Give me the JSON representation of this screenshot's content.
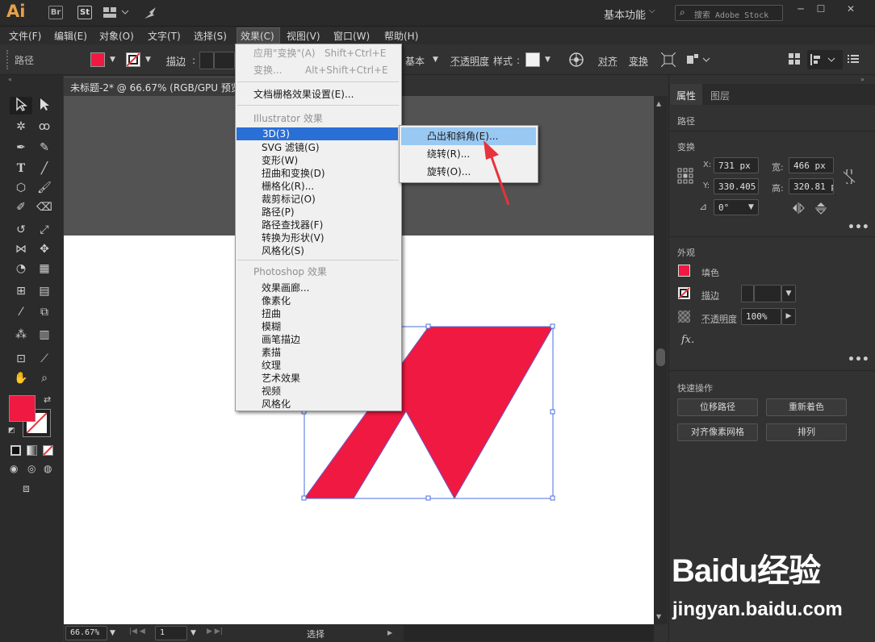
{
  "app": {
    "logo": "Ai",
    "bridge": "Br",
    "stock": "St",
    "workspace": "基本功能",
    "search_placeholder": "搜索 Adobe Stock"
  },
  "menubar": [
    "文件(F)",
    "编辑(E)",
    "对象(O)",
    "文字(T)",
    "选择(S)",
    "效果(C)",
    "视图(V)",
    "窗口(W)",
    "帮助(H)"
  ],
  "control": {
    "selection_type": "路径",
    "stroke_label": "描边",
    "style_label": "基本",
    "opacity_label": "不透明度",
    "styles_label": "样式",
    "align_label": "对齐",
    "transform_label": "变换",
    "fill_color": "#ef1941"
  },
  "document": {
    "tab_title": "未标题-2* @ 66.67% (RGB/GPU 预览)",
    "zoom": "66.67%",
    "artboard_index": "1",
    "status": "选择"
  },
  "effect_menu": {
    "apply_last": "应用\"变换\"(A)",
    "apply_last_shortcut": "Shift+Ctrl+E",
    "last_effect": "变换...",
    "last_effect_shortcut": "Alt+Shift+Ctrl+E",
    "raster_settings": "文档栅格效果设置(E)...",
    "illustrator_header": "Illustrator 效果",
    "illustrator_items": [
      "3D(3)",
      "SVG 滤镜(G)",
      "变形(W)",
      "扭曲和变换(D)",
      "栅格化(R)...",
      "裁剪标记(O)",
      "路径(P)",
      "路径查找器(F)",
      "转换为形状(V)",
      "风格化(S)"
    ],
    "photoshop_header": "Photoshop 效果",
    "photoshop_items": [
      "效果画廊...",
      "像素化",
      "扭曲",
      "模糊",
      "画笔描边",
      "素描",
      "纹理",
      "艺术效果",
      "视频",
      "风格化"
    ]
  },
  "submenu_3d": [
    "凸出和斜角(E)...",
    "绕转(R)...",
    "旋转(O)..."
  ],
  "properties_panel": {
    "tabs": [
      "属性",
      "图层"
    ],
    "object_type": "路径",
    "transform_title": "变换",
    "x_label": "X:",
    "x": "731 px",
    "y_label": "Y:",
    "y": "330.405",
    "w_label": "宽:",
    "w": "466 px",
    "h_label": "高:",
    "h": "320.81 p",
    "angle": "0°",
    "appearance_title": "外观",
    "fill_label": "填色",
    "stroke_label": "描边",
    "opacity_label": "不透明度",
    "opacity": "100%",
    "fx": "fx.",
    "quick_actions_title": "快速操作",
    "btn_offset_path": "位移路径",
    "btn_recolor": "重新着色",
    "btn_align_pixel": "对齐像素网格",
    "btn_arrange": "排列"
  },
  "watermark": {
    "logo": "Baidu经验",
    "url": "jingyan.baidu.com"
  },
  "colors": {
    "shape_fill": "#ef1941",
    "menu_highlight": "#2a6fd6",
    "submenu_highlight": "#99c9f3",
    "arrow": "#e8323c"
  }
}
